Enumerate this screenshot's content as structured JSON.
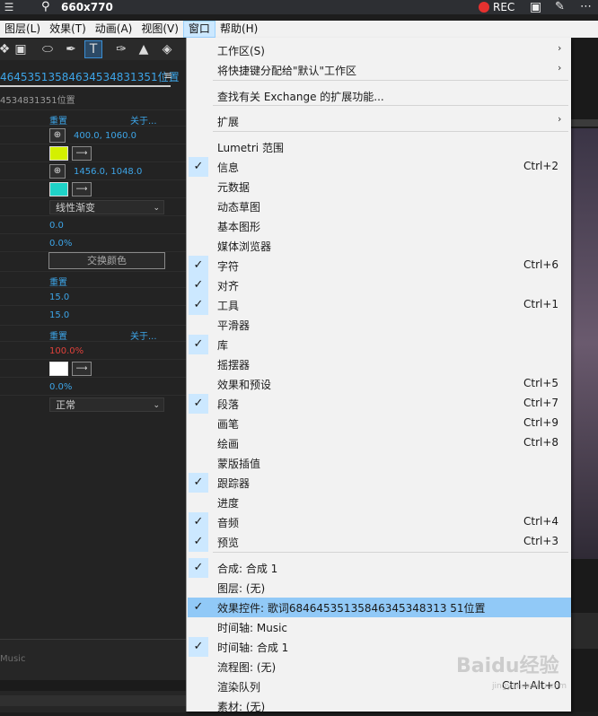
{
  "topbar": {
    "size_text": "660x770",
    "rec_label": "REC"
  },
  "menubar": {
    "items": [
      "图层(L)",
      "效果(T)",
      "动画(A)",
      "视图(V)",
      "窗口",
      "帮助(H)"
    ]
  },
  "panel": {
    "tab_title": "46453513584634534831351位置",
    "sub_title": "4534831351位置",
    "reset_label": "重置",
    "about_label": "关于...",
    "rows": {
      "r1_reset": "重置",
      "r1_about": "关于...",
      "point1": "400.0, 1060.0",
      "point2": "1456.0, 1048.0",
      "ramp_shape": "线性渐变",
      "v1": "0.0",
      "v2": "0.0%",
      "swap_colors": "交换颜色",
      "r2_reset": "重置",
      "v3": "15.0",
      "v4": "15.0",
      "r3_reset": "重置",
      "r3_about": "关于...",
      "v5": "100.0%",
      "v6": "0.0%",
      "blend_mode": "正常"
    },
    "colors": {
      "swatch1": "#d4f000",
      "swatch2": "#1fd3c8",
      "swatch3": "#ffffff"
    }
  },
  "bottom": {
    "music_label": "Music"
  },
  "dropdown": {
    "items": [
      {
        "label": "工作区(S)",
        "shortcut": "",
        "checked": false,
        "submenu": true
      },
      {
        "label": "将快捷键分配给\"默认\"工作区",
        "shortcut": "",
        "checked": false,
        "submenu": true
      },
      {
        "label": "查找有关 Exchange 的扩展功能...",
        "shortcut": "",
        "checked": false,
        "submenu": false
      },
      {
        "label": "扩展",
        "shortcut": "",
        "checked": false,
        "submenu": true
      },
      {
        "label": "Lumetri 范围",
        "shortcut": "",
        "checked": false,
        "submenu": false
      },
      {
        "label": "信息",
        "shortcut": "Ctrl+2",
        "checked": true,
        "submenu": false
      },
      {
        "label": "元数据",
        "shortcut": "",
        "checked": false,
        "submenu": false
      },
      {
        "label": "动态草图",
        "shortcut": "",
        "checked": false,
        "submenu": false
      },
      {
        "label": "基本图形",
        "shortcut": "",
        "checked": false,
        "submenu": false
      },
      {
        "label": "媒体浏览器",
        "shortcut": "",
        "checked": false,
        "submenu": false
      },
      {
        "label": "字符",
        "shortcut": "Ctrl+6",
        "checked": true,
        "submenu": false
      },
      {
        "label": "对齐",
        "shortcut": "",
        "checked": true,
        "submenu": false
      },
      {
        "label": "工具",
        "shortcut": "Ctrl+1",
        "checked": true,
        "submenu": false
      },
      {
        "label": "平滑器",
        "shortcut": "",
        "checked": false,
        "submenu": false
      },
      {
        "label": "库",
        "shortcut": "",
        "checked": true,
        "submenu": false
      },
      {
        "label": "摇摆器",
        "shortcut": "",
        "checked": false,
        "submenu": false
      },
      {
        "label": "效果和预设",
        "shortcut": "Ctrl+5",
        "checked": false,
        "submenu": false
      },
      {
        "label": "段落",
        "shortcut": "Ctrl+7",
        "checked": true,
        "submenu": false
      },
      {
        "label": "画笔",
        "shortcut": "Ctrl+9",
        "checked": false,
        "submenu": false
      },
      {
        "label": "绘画",
        "shortcut": "Ctrl+8",
        "checked": false,
        "submenu": false
      },
      {
        "label": "蒙版插值",
        "shortcut": "",
        "checked": false,
        "submenu": false
      },
      {
        "label": "跟踪器",
        "shortcut": "",
        "checked": true,
        "submenu": false
      },
      {
        "label": "进度",
        "shortcut": "",
        "checked": false,
        "submenu": false
      },
      {
        "label": "音频",
        "shortcut": "Ctrl+4",
        "checked": true,
        "submenu": false
      },
      {
        "label": "预览",
        "shortcut": "Ctrl+3",
        "checked": true,
        "submenu": false
      },
      {
        "label": "合成: 合成 1",
        "shortcut": "",
        "checked": true,
        "submenu": false
      },
      {
        "label": "图层: (无)",
        "shortcut": "",
        "checked": false,
        "submenu": false
      },
      {
        "label": "效果控件: 歌词68464535135846345348313 51位置",
        "shortcut": "",
        "checked": true,
        "submenu": false,
        "highlighted": true
      },
      {
        "label": "时间轴: Music",
        "shortcut": "",
        "checked": false,
        "submenu": false
      },
      {
        "label": "时间轴: 合成 1",
        "shortcut": "",
        "checked": true,
        "submenu": false
      },
      {
        "label": "流程图: (无)",
        "shortcut": "",
        "checked": false,
        "submenu": false
      },
      {
        "label": "渲染队列",
        "shortcut": "Ctrl+Alt+0",
        "checked": false,
        "submenu": false
      },
      {
        "label": "素材: (无)",
        "shortcut": "",
        "checked": false,
        "submenu": false
      }
    ]
  },
  "watermark": {
    "brand": "Baidu经验",
    "sub": "jingyan.baidu.com"
  }
}
